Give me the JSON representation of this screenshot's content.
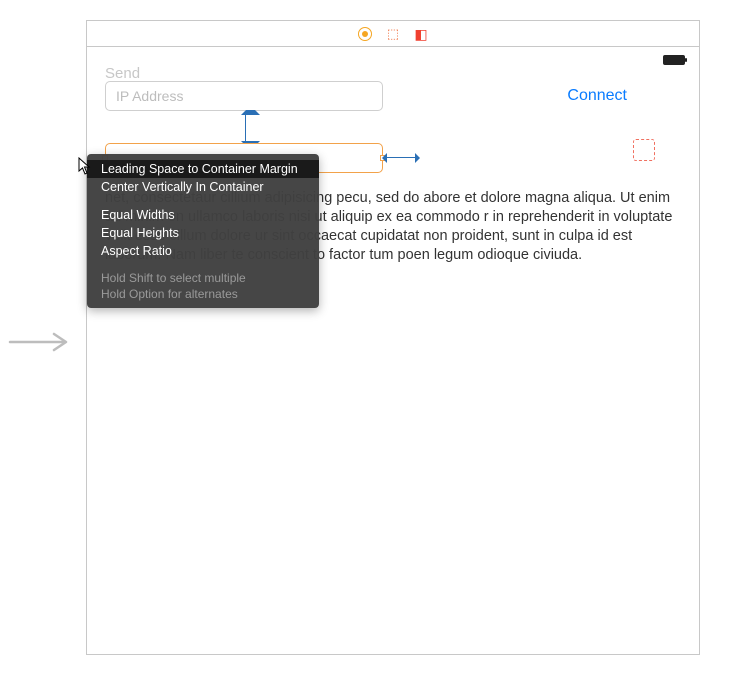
{
  "toolbar": {
    "icons": [
      "breakpoint-circle",
      "cube-3d",
      "stack-layers"
    ]
  },
  "status": {
    "battery": "full"
  },
  "fields": {
    "ip": {
      "placeholder": "IP Address",
      "value": ""
    },
    "message": {
      "placeholder": "",
      "value": ""
    }
  },
  "buttons": {
    "connect": "Connect",
    "send": "Send"
  },
  "body_text": "net, consectetaur cillium adipisicing pecu, sed do abore et dolore magna aliqua. Ut enim ad minim on ullamco laboris nisi ut aliquip ex ea commodo r in reprehenderit in voluptate velit esse cillum dolore ur sint occaecat cupidatat non proident, sunt in culpa id est laborum. Nam liber te conscient to factor tum poen legum odioque civiuda.",
  "context_menu": {
    "items": [
      "Leading Space to Container Margin",
      "Center Vertically In Container",
      "Equal Widths",
      "Equal Heights",
      "Aspect Ratio"
    ],
    "hints": [
      "Hold Shift to select multiple",
      "Hold Option for alternates"
    ]
  }
}
